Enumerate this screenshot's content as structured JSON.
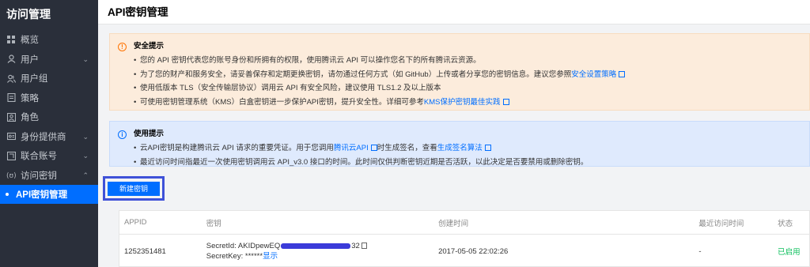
{
  "sidebar": {
    "title": "访问管理",
    "items": [
      {
        "label": "概览",
        "icon": "grid-icon"
      },
      {
        "label": "用户",
        "icon": "user-icon",
        "chevron": "⌄"
      },
      {
        "label": "用户组",
        "icon": "users-icon"
      },
      {
        "label": "策略",
        "icon": "policy-icon"
      },
      {
        "label": "角色",
        "icon": "role-icon"
      },
      {
        "label": "身份提供商",
        "icon": "idp-icon",
        "chevron": "⌄"
      },
      {
        "label": "联合账号",
        "icon": "federated-icon",
        "chevron": "⌄"
      },
      {
        "label": "访问密钥",
        "icon": "key-icon",
        "chevron": "⌃"
      }
    ],
    "active_sub": "API密钥管理"
  },
  "header": {
    "title": "API密钥管理"
  },
  "warning": {
    "title": "安全提示",
    "items": [
      {
        "text": "您的 API 密钥代表您的账号身份和所拥有的权限，使用腾讯云 API 可以操作您名下的所有腾讯云资源。",
        "link": ""
      },
      {
        "text": "为了您的财产和服务安全，请妥善保存和定期更换密钥，请勿通过任何方式（如 GitHub）上传或者分享您的密钥信息。建议您参照",
        "link": "安全设置策略"
      },
      {
        "text": "使用低版本 TLS（安全传输层协议）调用云 API 有安全风险，建议使用 TLS1.2 及以上版本",
        "link": ""
      },
      {
        "text": "可使用密钥管理系统（KMS）白盒密钥进一步保护API密钥，提升安全性。详细可参考",
        "link": "KMS保护密钥最佳实践"
      }
    ]
  },
  "info": {
    "title": "使用提示",
    "item1_text": "云API密钥是构建腾讯云 API 请求的重要凭证。用于您调用",
    "item1_link1": "腾讯云API",
    "item1_mid": "时生成签名，查看",
    "item1_link2": "生成签名算法",
    "item2_text": "最近访问时间指最近一次使用密钥调用云 API_v3.0 接口的时间。此时间仅供判断密钥近期是否活跃，以此决定是否要禁用或删除密钥。"
  },
  "create_button": "新建密钥",
  "table": {
    "columns": [
      "APPID",
      "密钥",
      "创建时间",
      "最近访问时间",
      "状态"
    ],
    "rows": [
      {
        "appid": "1252351481",
        "secret_id_label": "SecretId: AKIDpewEQ",
        "secret_id_tail": "32",
        "secret_key_label": "SecretKey: ******",
        "show_link": "显示",
        "created": "2017-05-05 22:02:26",
        "last_access": "-",
        "status": "已启用"
      }
    ]
  },
  "colors": {
    "primary": "#006eff",
    "warning": "#ff7200",
    "success": "#0abf5b",
    "highlight_box": "#3f51d8"
  }
}
